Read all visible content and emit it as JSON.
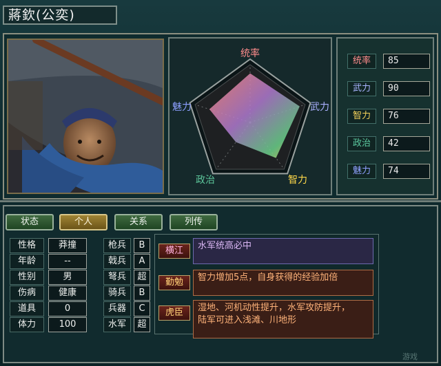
{
  "header": {
    "name": "蔣欽(公奕)"
  },
  "radar": {
    "axes": [
      "统率",
      "武力",
      "智力",
      "政治",
      "魅力"
    ],
    "axis_colors": [
      "#ff8c8c",
      "#aab0ff",
      "#ffd94a",
      "#5cc59a",
      "#8ca0ff"
    ]
  },
  "stats": [
    {
      "label": "统率",
      "value": "85",
      "color": "#ff8c8c"
    },
    {
      "label": "武力",
      "value": "90",
      "color": "#a8b4ff"
    },
    {
      "label": "智力",
      "value": "76",
      "color": "#f2d05a"
    },
    {
      "label": "政治",
      "value": "42",
      "color": "#5ccaa0"
    },
    {
      "label": "魅力",
      "value": "74",
      "color": "#8fa0ff"
    }
  ],
  "tabs": [
    {
      "label": "状态",
      "active": false
    },
    {
      "label": "个人",
      "active": true
    },
    {
      "label": "关系",
      "active": false
    },
    {
      "label": "列传",
      "active": false
    }
  ],
  "personal": [
    {
      "label": "性格",
      "value": "莽撞"
    },
    {
      "label": "年龄",
      "value": "--"
    },
    {
      "label": "性别",
      "value": "男"
    },
    {
      "label": "伤病",
      "value": "健康"
    },
    {
      "label": "道具",
      "value": "0"
    },
    {
      "label": "体力",
      "value": "100"
    }
  ],
  "aptitudes": [
    {
      "label": "枪兵",
      "grade": "B"
    },
    {
      "label": "戟兵",
      "grade": "A"
    },
    {
      "label": "弩兵",
      "grade": "超"
    },
    {
      "label": "骑兵",
      "grade": "B"
    },
    {
      "label": "兵器",
      "grade": "C"
    },
    {
      "label": "水军",
      "grade": "超"
    }
  ],
  "skills": [
    {
      "name": "横江",
      "name_color": "#ffb3e0",
      "desc_line1": "水军统高必中",
      "desc_line2": "",
      "style": "purple"
    },
    {
      "name": "勤勉",
      "name_color": "#ffd278",
      "desc_line1": "智力增加5点，自身获得的经验加倍",
      "desc_line2": "",
      "style": "orange"
    },
    {
      "name": "虎臣",
      "name_color": "#ffd278",
      "desc_line1": "湿地、河机动性提升，水军攻防提升，",
      "desc_line2": "陆军可进入浅滩、川地形",
      "style": "orange"
    }
  ],
  "watermark": "游戏"
}
